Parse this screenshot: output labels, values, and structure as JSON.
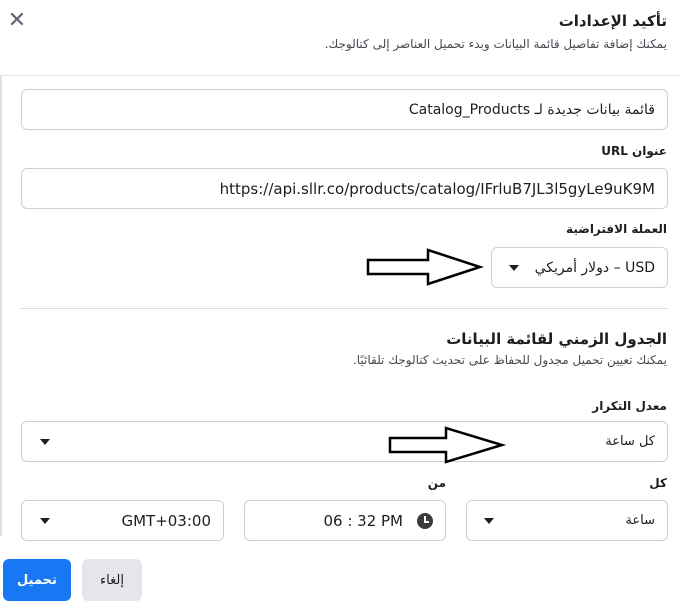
{
  "header": {
    "title": "تأكيد الإعدادات",
    "subtitle": "يمكنك إضافة تفاصيل قائمة البيانات وبدء تحميل العناصر إلى كتالوجك."
  },
  "form": {
    "name_value": "قائمة بيانات جديدة لـ Catalog_Products",
    "url_label": "عنوان URL",
    "url_value": "https://api.sllr.co/products/catalog/IFrluB7JL3l5gyLe9uK9M",
    "currency_label": "العملة الافتراضية",
    "currency_value": "USD – دولار أمريكي"
  },
  "schedule": {
    "title": "الجدول الزمني لقائمة البيانات",
    "description": "يمكنك تعيين تحميل مجدول للحفاظ على تحديث كتالوجك تلقائيًا.",
    "frequency_label": "معدل التكرار",
    "frequency_value": "كل ساعة",
    "every_label": "كل",
    "every_value": "ساعة",
    "from_label": "من",
    "time_value": "06 : 32 PM",
    "timezone_value": "GMT+03:00"
  },
  "footer": {
    "upload_label": "تحميل",
    "cancel_label": "إلغاء"
  },
  "icons": {
    "close": "close-icon",
    "clock": "clock-icon",
    "caret": "chevron-down-icon",
    "arrow": "arrow-right-annotation"
  },
  "colors": {
    "primary": "#1877f2",
    "secondary_bg": "#e4e6eb",
    "border": "#ccd0d5"
  }
}
